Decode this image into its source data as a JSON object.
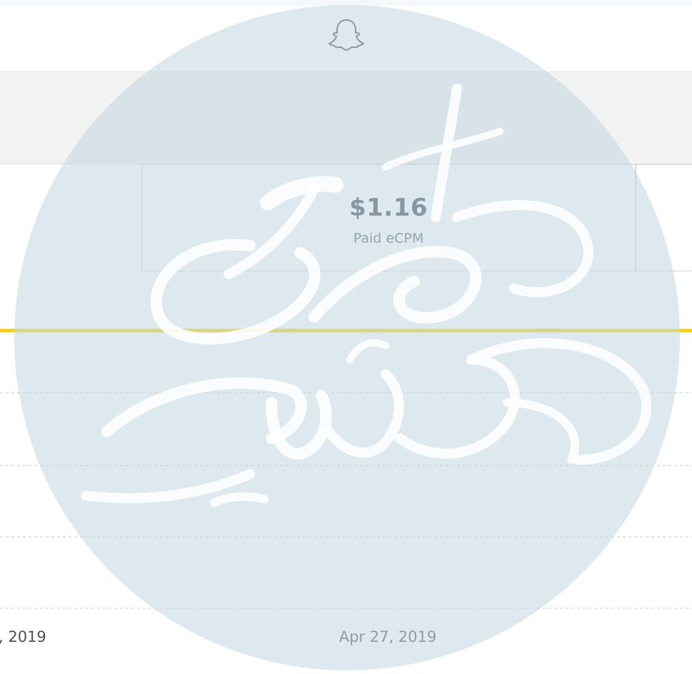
{
  "header": {
    "icon": "snapchat-ghost-icon"
  },
  "metric": {
    "value": "$1.16",
    "label": "Paid eCPM"
  },
  "chart_data": {
    "type": "line",
    "x": [
      "",
      "Apr 27, 2019"
    ],
    "x_tick_labels": [
      ", 2019",
      "Apr 27, 2019"
    ],
    "series": [
      {
        "color": "#f2d21b",
        "values": [
          1.16,
          1.16
        ]
      }
    ],
    "grid": true
  },
  "colors": {
    "accent": "#f2d21b",
    "watermark": "#dbe7ee"
  }
}
